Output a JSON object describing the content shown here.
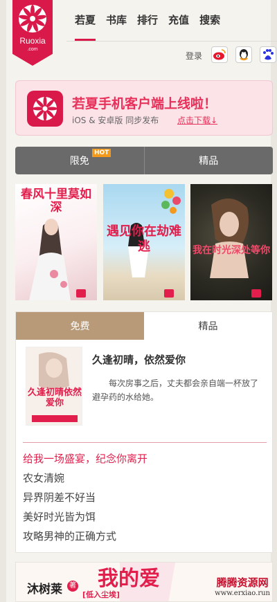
{
  "brand": {
    "name": "Ruoxia",
    "sub": ".com"
  },
  "nav": {
    "items": [
      "若夏",
      "书库",
      "排行",
      "充值",
      "搜索"
    ],
    "active": "若夏"
  },
  "header": {
    "login": "登录",
    "social": [
      "weibo-icon",
      "qq-icon",
      "baidu-icon"
    ]
  },
  "banner": {
    "title": "若夏手机客户端上线啦！",
    "subtitle": "iOS & 安卓版  同步发布",
    "download": "点击下载↓"
  },
  "tabs_top": {
    "items": [
      "限免",
      "精品"
    ],
    "badge": "HOT"
  },
  "covers": [
    {
      "title": "春风十里莫如深"
    },
    {
      "title": "遇见你在劫难逃"
    },
    {
      "title": "我在时光深处等你"
    }
  ],
  "tabs_bottom": {
    "items": [
      "免费",
      "精品"
    ],
    "active": "免费"
  },
  "featured": {
    "cover_text": "久逢初晴依然爱你",
    "title": "久逢初晴，依然爱你",
    "desc": "每次房事之后，丈夫都会亲自端一杯放了避孕药的水给她。"
  },
  "book_list": [
    "给我一场盛宴，纪念你离开",
    "农女清婉",
    "异界阴差不好当",
    "美好时光皆为饵",
    "攻略男神的正确方式"
  ],
  "bottom_banner": {
    "author": "沐树莱",
    "author_badge": "著",
    "title": "我的爱",
    "tag": "[低入尘埃]"
  },
  "watermark": {
    "name": "腾腾资源网",
    "url": "www.erxiao.run"
  },
  "colors": {
    "brand": "#d8194a",
    "tab_active": "#b99a78",
    "tab_bar": "#6a6a6a",
    "hot": "#f39a1c"
  }
}
